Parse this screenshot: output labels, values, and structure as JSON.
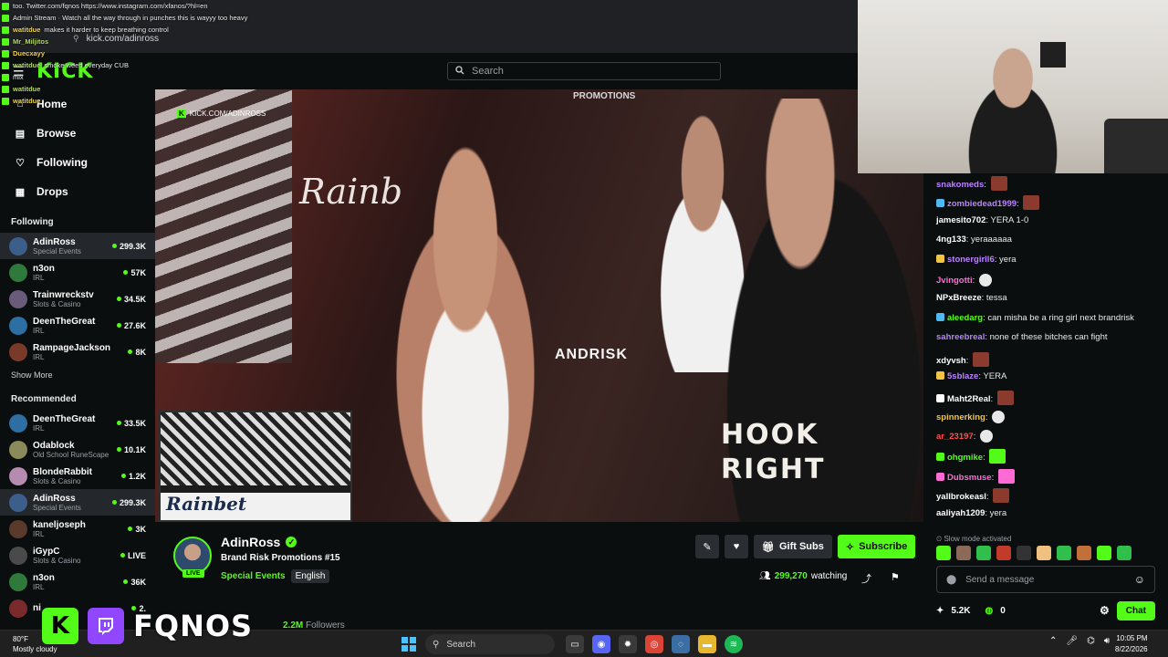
{
  "browser": {
    "url": "kick.com/adinross",
    "overlay_chat": [
      {
        "user": "",
        "text": "too. Twitter.com/fqnos https://www.instagram.com/xfanos/?hl=en"
      },
      {
        "user": "",
        "text": "Admin Stream · Watch all the way through in punches this is wayyy too heavy"
      },
      {
        "user": "watitdue",
        "text": "makes it harder to keep breathing control"
      },
      {
        "user": "Mr_Miljitos",
        "text": ""
      },
      {
        "user": "Duecxayy",
        "text": ""
      },
      {
        "user": "watitdue",
        "text": "smoke weed everyday CUB"
      },
      {
        "user": "",
        "text": "mix"
      },
      {
        "user": "watitdue",
        "text": ""
      },
      {
        "user": "watitdue",
        "text": ""
      }
    ]
  },
  "header": {
    "logo": "KICK",
    "search_placeholder": "Search"
  },
  "sidebar": {
    "nav": [
      {
        "label": "Home",
        "icon": "home-icon"
      },
      {
        "label": "Browse",
        "icon": "browse-icon"
      },
      {
        "label": "Following",
        "icon": "heart-icon"
      },
      {
        "label": "Drops",
        "icon": "drops-icon"
      }
    ],
    "following_heading": "Following",
    "following": [
      {
        "name": "AdinRoss",
        "category": "Special Events",
        "viewers": "299.3K",
        "color": "#3b5f8a",
        "active": true
      },
      {
        "name": "n3on",
        "category": "IRL",
        "viewers": "57K",
        "color": "#2f7a3b"
      },
      {
        "name": "Trainwreckstv",
        "category": "Slots & Casino",
        "viewers": "34.5K",
        "color": "#6b5b7b"
      },
      {
        "name": "DeenTheGreat",
        "category": "IRL",
        "viewers": "27.6K",
        "color": "#2d6fa3"
      },
      {
        "name": "RampageJackson",
        "category": "IRL",
        "viewers": "8K",
        "color": "#7a3a2a"
      }
    ],
    "show_more": "Show More",
    "recommended_heading": "Recommended",
    "recommended": [
      {
        "name": "DeenTheGreat",
        "category": "IRL",
        "viewers": "33.5K",
        "color": "#2d6fa3"
      },
      {
        "name": "Odablock",
        "category": "Old School RuneScape",
        "viewers": "10.1K",
        "color": "#8a8a5a"
      },
      {
        "name": "BlondeRabbit",
        "category": "Slots & Casino",
        "viewers": "1.2K",
        "color": "#b58bb0"
      },
      {
        "name": "AdinRoss",
        "category": "Special Events",
        "viewers": "299.3K",
        "color": "#3b5f8a",
        "active": true
      },
      {
        "name": "kaneljoseph",
        "category": "IRL",
        "viewers": "3K",
        "color": "#5a3a2a"
      },
      {
        "name": "iGypC",
        "category": "Slots & Casino",
        "viewers": "LIVE",
        "color": "#4a4a4a"
      },
      {
        "name": "n3on",
        "category": "IRL",
        "viewers": "36K",
        "color": "#2f7a3b"
      },
      {
        "name": "ni",
        "category": "",
        "viewers": "2.",
        "color": "#7a2a2a"
      }
    ]
  },
  "video": {
    "kick_tag": "KICK.COM/ADINROSS",
    "ring_text_1": "Rainb",
    "ring_text_2": "ANDRISK",
    "promo_text": "PROMOTIONS",
    "shirt_text": "HOOK RIGHT",
    "pip_logo": "Rainbet"
  },
  "stream": {
    "streamer": "AdinRoss",
    "live_label": "LIVE",
    "title": "Brand Risk Promotions #15",
    "category": "Special Events",
    "language": "English",
    "gift_label": "Gift Subs",
    "subscribe_label": "Subscribe",
    "viewers": "299,270",
    "viewers_suffix": "watching",
    "followers": "2.2M",
    "followers_label": "Followers"
  },
  "chat": {
    "messages": [
      {
        "user": "snakomeds",
        "color": "#b982ff",
        "text": "",
        "emote": "red"
      },
      {
        "user": "zombiedead1999",
        "color": "#b982ff",
        "text": "",
        "emote": "red",
        "badge": "#4fb9f0"
      },
      {
        "user": "jamesito702",
        "color": "#ffffff",
        "text": "YERA 1-0"
      },
      {
        "user": "4ng133",
        "color": "#ffffff",
        "text": "yeraaaaaa"
      },
      {
        "user": "stonergirll6",
        "color": "#b982ff",
        "text": "yera",
        "badge": "#f5c542"
      },
      {
        "user": "Jvingotti",
        "color": "#ff6ad5",
        "text": "",
        "emote": "white"
      },
      {
        "user": "NPxBreeze",
        "color": "#ffffff",
        "text": "tessa"
      },
      {
        "user": "aleedarg",
        "color": "#53fc18",
        "text": "can misha be a ring girl next brandrisk",
        "badge": "#4fb9f0"
      },
      {
        "user": "sahreebreal",
        "color": "#b982ff",
        "text": "none of these bitches can fight"
      },
      {
        "user": "xdyvsh",
        "color": "#ffffff",
        "text": "",
        "emote": "red"
      },
      {
        "user": "5sblaze",
        "color": "#b982ff",
        "text": "YERA",
        "badge": "#f5c542"
      },
      {
        "user": "Maht2Real",
        "color": "#ffffff",
        "text": "",
        "emote": "red",
        "badge": "#ffffff"
      },
      {
        "user": "spinnerking",
        "color": "#f5c542",
        "text": "",
        "emote": "white"
      },
      {
        "user": "ar_23197",
        "color": "#ff4d4d",
        "text": "",
        "emote": "white"
      },
      {
        "user": "ohgmike",
        "color": "#53fc18",
        "text": "",
        "emote": "green",
        "badge": "#53fc18"
      },
      {
        "user": "Dubsmuse",
        "color": "#ff6ad5",
        "text": "",
        "emote": "pink",
        "badge": "#ff6ad5"
      },
      {
        "user": "yallbrokeasl",
        "color": "#ffffff",
        "text": "",
        "emote": "red"
      },
      {
        "user": "aaliyah1209",
        "color": "#ffffff",
        "text": "yera"
      }
    ],
    "slow_mode": "Slow mode activated",
    "input_placeholder": "Send a message",
    "kicks": "5.2K",
    "points": "0",
    "chat_button": "Chat"
  },
  "watermark": {
    "k_letter": "K",
    "text": "FQNOS"
  },
  "taskbar": {
    "weather_temp": "80°F",
    "weather_desc": "Mostly cloudy",
    "search": "Search",
    "time": "10:05 PM",
    "date": "8/22/2026"
  },
  "colors": {
    "accent": "#53fc18",
    "background": "#0b0e0f",
    "twitch": "#9146ff"
  }
}
